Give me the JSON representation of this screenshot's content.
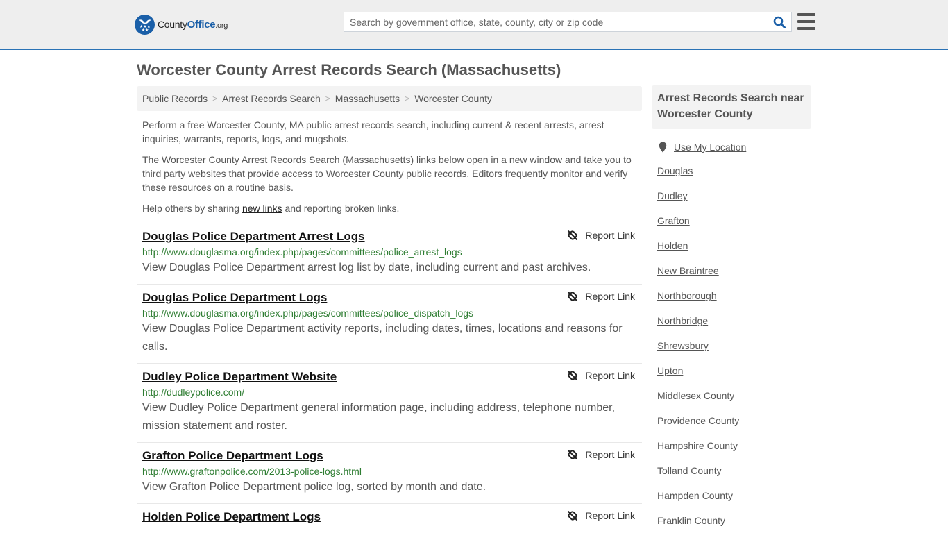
{
  "header": {
    "logo": {
      "brand_prefix": "County",
      "brand_main": "Office",
      "brand_suffix": ".org",
      "icon": "eagle-stars-badge-icon"
    },
    "search": {
      "placeholder": "Search by government office, state, county, city or zip code",
      "value": "",
      "icon": "search-icon"
    },
    "menu_icon": "hamburger-menu-icon",
    "colors": {
      "brand_blue": "#1a5fa8",
      "header_bg": "#eeeeee",
      "header_border": "#2a72b5"
    }
  },
  "page": {
    "title": "Worcester County Arrest Records Search (Massachusetts)",
    "breadcrumb": [
      "Public Records",
      "Arrest Records Search",
      "Massachusetts",
      "Worcester County"
    ],
    "intro": {
      "p1": "Perform a free Worcester County, MA public arrest records search, including current & recent arrests, arrest inquiries, warrants, reports, logs, and mugshots.",
      "p2": "The Worcester County Arrest Records Search (Massachusetts) links below open in a new window and take you to third party websites that provide access to Worcester County public records. Editors frequently monitor and verify these resources on a routine basis.",
      "p3_before": "Help others by sharing ",
      "p3_link": "new links",
      "p3_after": " and reporting broken links."
    },
    "report_label": "Report Link",
    "results": [
      {
        "title": "Douglas Police Department Arrest Logs",
        "url": "http://www.douglasma.org/index.php/pages/committees/police_arrest_logs",
        "description": "View Douglas Police Department arrest log list by date, including current and past archives."
      },
      {
        "title": "Douglas Police Department Logs",
        "url": "http://www.douglasma.org/index.php/pages/committees/police_dispatch_logs",
        "description": "View Douglas Police Department activity reports, including dates, times, locations and reasons for calls."
      },
      {
        "title": "Dudley Police Department Website",
        "url": "http://dudleypolice.com/",
        "description": "View Dudley Police Department general information page, including address, telephone number, mission statement and roster."
      },
      {
        "title": "Grafton Police Department Logs",
        "url": "http://www.graftonpolice.com/2013-police-logs.html",
        "description": "View Grafton Police Department police log, sorted by month and date."
      },
      {
        "title": "Holden Police Department Logs",
        "url": "",
        "description": ""
      }
    ],
    "colors": {
      "url_green": "#2e7d32",
      "text": "#555555",
      "title": "#111111"
    }
  },
  "sidebar": {
    "heading": "Arrest Records Search near Worcester County",
    "use_location": "Use My Location",
    "location_icon": "map-pin-icon",
    "links": [
      "Douglas",
      "Dudley",
      "Grafton",
      "Holden",
      "New Braintree",
      "Northborough",
      "Northbridge",
      "Shrewsbury",
      "Upton",
      "Middlesex County",
      "Providence County",
      "Hampshire County",
      "Tolland County",
      "Hampden County",
      "Franklin County"
    ]
  }
}
